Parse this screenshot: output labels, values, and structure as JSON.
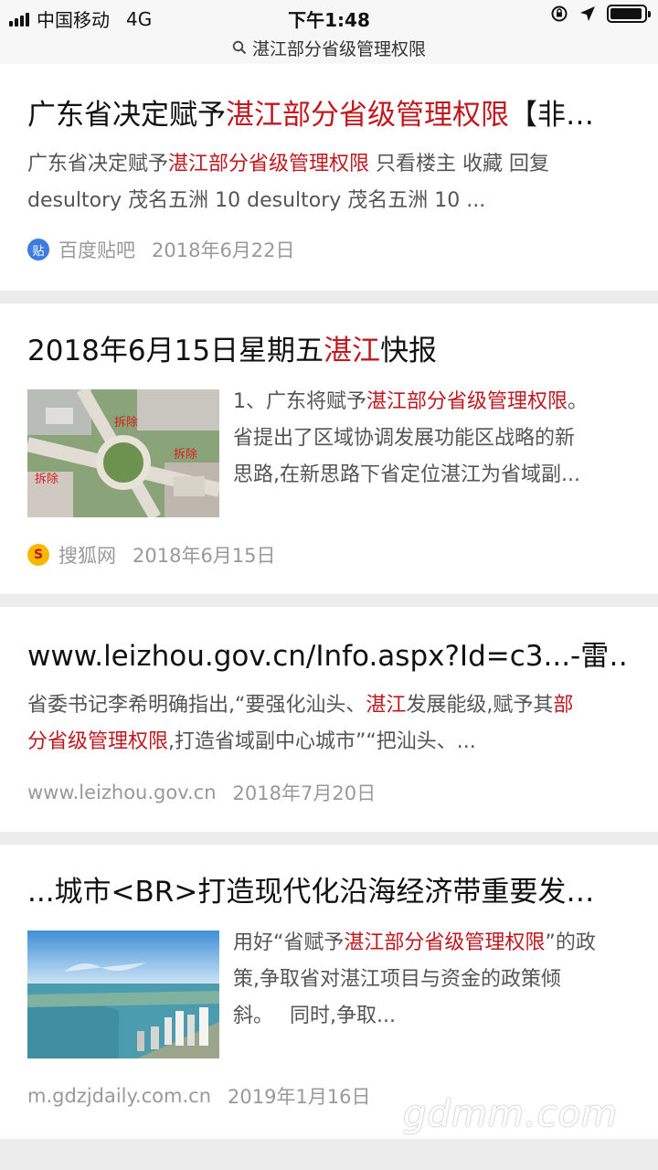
{
  "status_bar": {
    "carrier": "中国移动",
    "network": "4G",
    "time": "下午1:48"
  },
  "url_bar": {
    "query": "湛江部分省级管理权限"
  },
  "results": [
    {
      "title_prefix": "广东省决定赋予",
      "title_highlight": "湛江部分省级管理权限",
      "title_suffix": "【非…",
      "desc_line1_prefix": "广东省决定赋予",
      "desc_line1_highlight": "湛江部分省级管理权限",
      "desc_line1_suffix": " 只看楼主 收藏 回复",
      "desc_line2": "desultory 茂名五洲 10 desultory 茂名五洲 10 ...",
      "source_icon": "tieba-icon",
      "source_icon_text": "贴",
      "source_name": "百度贴吧",
      "date": "2018年6月22日"
    },
    {
      "title_prefix": "2018年6月15日星期五",
      "title_highlight": "湛江",
      "title_suffix": "快报",
      "desc_line1_prefix": "1、广东将赋予",
      "desc_line1_highlight": "湛江部分省级管理权限",
      "desc_line1_suffix": "。",
      "desc_line2": "省提出了区域协调发展功能区战略的新",
      "desc_line3": "思路,在新思路下省定位湛江为省域副...",
      "thumb_labels": [
        "拆除",
        "拆除",
        "拆除"
      ],
      "source_icon": "sohu-icon",
      "source_icon_text": "S",
      "source_name": "搜狐网",
      "date": "2018年6月15日"
    },
    {
      "title": "www.leizhou.gov.cn/Info.aspx?Id=c3...-雷…",
      "desc_line1_prefix": "省委书记李希明确指出,“要强化汕头、",
      "desc_line1_highlight": "湛江",
      "desc_line1_mid": "发展能级,赋予其",
      "desc_line1_highlight2": "部",
      "desc_line2_highlight": "分省级管理权限",
      "desc_line2_suffix": ",打造省域副中心城市”“把汕头、...",
      "source_name": "www.leizhou.gov.cn",
      "date": "2018年7月20日"
    },
    {
      "title": "...城市<BR>打造现代化沿海经济带重要发…",
      "desc_line1_prefix": "用好“省赋予",
      "desc_line1_highlight": "湛江部分省级管理权限",
      "desc_line1_suffix": "”的政",
      "desc_line2": "策,争取省对湛江项目与资金的政策倾",
      "desc_line3": "斜。　 同时,争取...",
      "source_name": "m.gdzjdaily.com.cn",
      "date": "2019年1月16日"
    }
  ],
  "watermark": "gdmm.com",
  "colors": {
    "highlight": "#c0181e",
    "background": "#ececec",
    "card": "#ffffff",
    "muted": "#999999"
  }
}
